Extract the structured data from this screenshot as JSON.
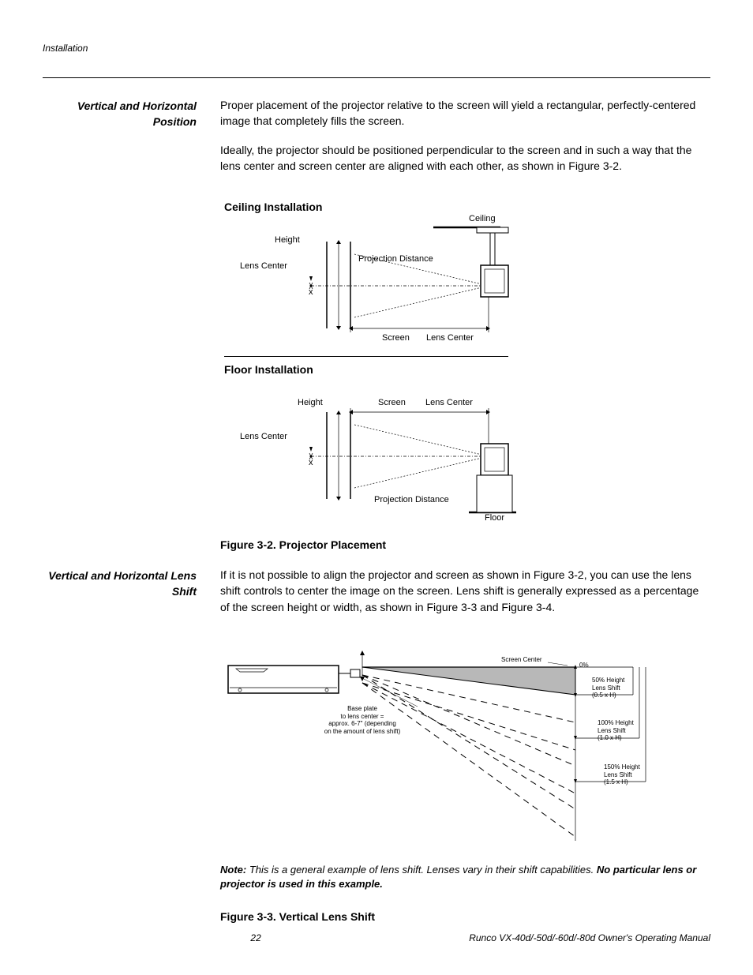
{
  "header": {
    "section": "Installation"
  },
  "section1": {
    "side": "Vertical and Horizontal Position",
    "p1": "Proper placement of the projector relative to the screen will yield a rectangular, perfectly-centered image that completely fills the screen.",
    "p2": "Ideally, the projector should be positioned perpendicular to the screen and in such a way that the lens center and screen center are aligned with each other, as shown in Figure 3-2."
  },
  "fig32": {
    "title_ceiling": "Ceiling Installation",
    "title_floor": "Floor Installation",
    "caption": "Figure 3-2. Projector Placement",
    "labels": {
      "ceiling": "Ceiling",
      "height": "Height",
      "lens_center": "Lens Center",
      "x": "x",
      "proj_dist": "Projection Distance",
      "screen": "Screen",
      "floor": "Floor"
    }
  },
  "section2": {
    "side": "Vertical and Horizontal Lens Shift",
    "p1": "If it is not possible to align the projector and screen as shown in Figure 3-2, you can use the lens shift controls to center the image on the screen. Lens shift is generally expressed as a percentage of the screen height or width, as shown in Figure 3-3 and Figure 3-4."
  },
  "fig33": {
    "labels": {
      "screen_center": "Screen Center",
      "zero": "0%",
      "base_plate": "Base plate\nto lens center =\napprox. 6-7\" (depending\non the amount of lens shift)",
      "s50_a": "50% Height",
      "s50_b": "Lens Shift",
      "s50_c": "(0.5 x H)",
      "s100_a": "100% Height",
      "s100_b": "Lens Shift",
      "s100_c": "(1.0 x H)",
      "s150_a": "150% Height",
      "s150_b": "Lens Shift",
      "s150_c": "(1.5 x H)"
    },
    "note_label": "Note:",
    "note_text": " This is a general example of lens shift. Lenses vary in their shift capabilities. ",
    "note_bold": "No particular lens or projector is used in this example.",
    "caption": "Figure 3-3. Vertical Lens Shift"
  },
  "footer": {
    "page": "22",
    "doc": "Runco VX-40d/-50d/-60d/-80d Owner's Operating Manual"
  }
}
